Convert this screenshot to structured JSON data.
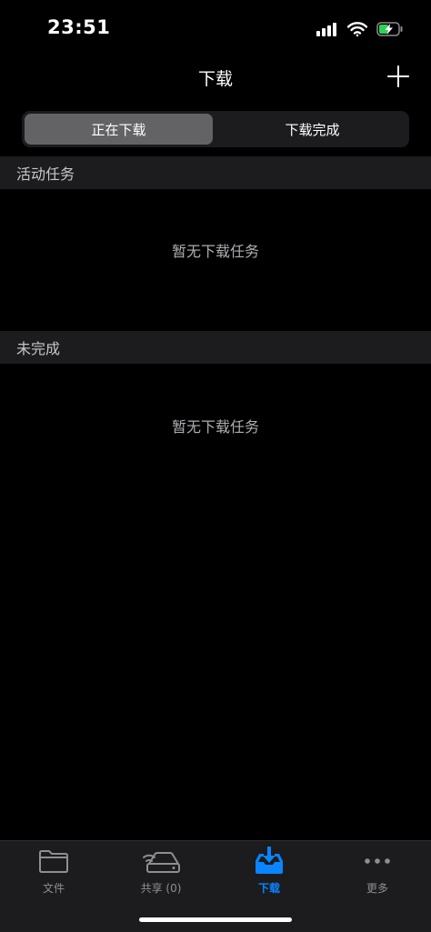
{
  "status_bar": {
    "time": "23:51"
  },
  "nav": {
    "title": "下载"
  },
  "segmented_control": {
    "options": [
      {
        "label": "正在下载",
        "selected": true
      },
      {
        "label": "下载完成",
        "selected": false
      }
    ]
  },
  "sections": [
    {
      "header": "活动任务",
      "empty_text": "暂无下载任务"
    },
    {
      "header": "未完成",
      "empty_text": "暂无下载任务"
    }
  ],
  "tab_bar": {
    "items": [
      {
        "label": "文件",
        "icon": "folder-icon",
        "active": false
      },
      {
        "label": "共享 (0)",
        "icon": "network-drive-icon",
        "active": false
      },
      {
        "label": "下载",
        "icon": "download-tray-icon",
        "active": true
      },
      {
        "label": "更多",
        "icon": "more-dots-icon",
        "active": false
      }
    ]
  },
  "colors": {
    "accent": "#0a84ff",
    "background": "#000000",
    "section_background": "#1c1c1e",
    "selected_segment": "#636366",
    "battery_charging": "#30d158"
  }
}
